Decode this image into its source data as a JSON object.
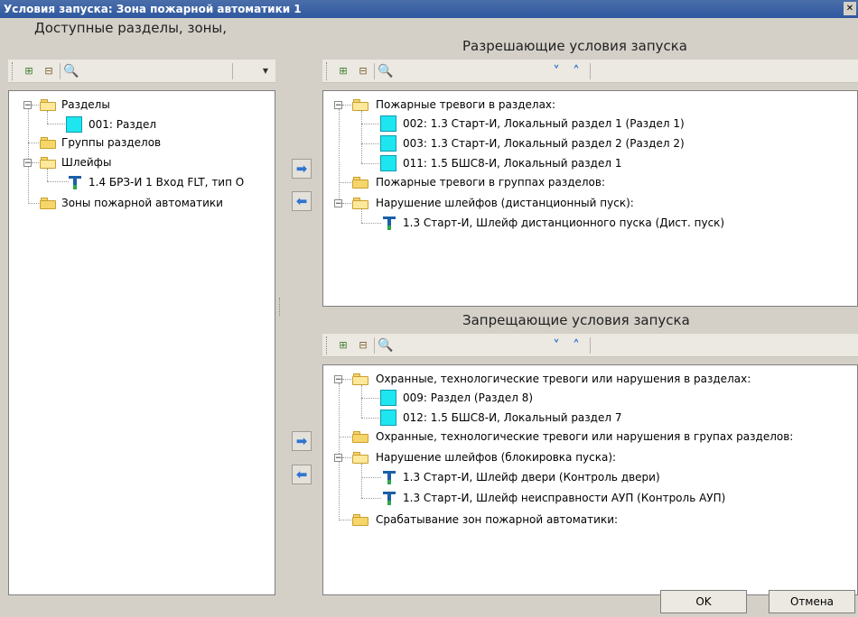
{
  "window": {
    "title": "Условия запуска: Зона пожарной автоматики 1"
  },
  "left_panel": {
    "header": "Доступные разделы, зоны,",
    "tree": [
      {
        "label": "Разделы"
      },
      {
        "label": "001: Раздел"
      },
      {
        "label": "Группы разделов"
      },
      {
        "label": "Шлейфы"
      },
      {
        "label": "1.4 БРЗ-И  1 Вход FLT, тип О"
      },
      {
        "label": "Зоны пожарной автоматики"
      }
    ]
  },
  "allow_panel": {
    "header": "Разрешающие условия запуска",
    "tree": [
      {
        "label": "Пожарные тревоги в разделах:"
      },
      {
        "label": "002: 1.3 Старт-И, Локальный раздел 1 (Раздел 1)"
      },
      {
        "label": "003: 1.3 Старт-И, Локальный раздел 2 (Раздел 2)"
      },
      {
        "label": "011: 1.5 БШС8-И, Локальный раздел 1"
      },
      {
        "label": "Пожарные тревоги в группах разделов:"
      },
      {
        "label": "Нарушение шлейфов (дистанционный пуск):"
      },
      {
        "label": "1.3 Старт-И, Шлейф дистанционного пуска (Дист. пуск)"
      }
    ]
  },
  "deny_panel": {
    "header": "Запрещающие условия запуска",
    "tree": [
      {
        "label": "Охранные, технологические тревоги или нарушения в разделах:"
      },
      {
        "label": "009: Раздел (Раздел 8)"
      },
      {
        "label": "012: 1.5 БШС8-И, Локальный раздел 7"
      },
      {
        "label": "Охранные, технологические тревоги или нарушения в групах разделов:"
      },
      {
        "label": "Нарушение шлейфов (блокировка пуска):"
      },
      {
        "label": "1.3 Старт-И, Шлейф двери (Контроль двери)"
      },
      {
        "label": "1.3 Старт-И, Шлейф неисправности АУП (Контроль АУП)"
      },
      {
        "label": "Срабатывание зон пожарной автоматики:"
      }
    ]
  },
  "icons": {
    "expand": "⊟",
    "search": "🔍",
    "down": "⌄",
    "up": "⌃",
    "move_right": "➡",
    "move_left": "⬅"
  },
  "buttons": {
    "ok": "OK",
    "cancel": "Отмена"
  }
}
